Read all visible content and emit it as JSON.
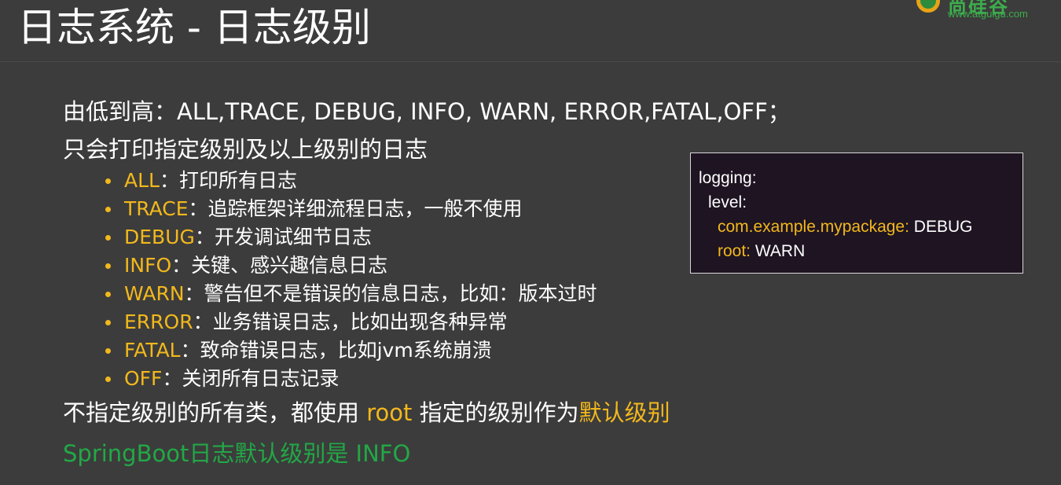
{
  "slide": {
    "title": "日志系统 - 日志级别",
    "logo": {
      "brand": "尚硅谷",
      "url": "www.atguigu.com"
    },
    "range_text": "由低到高：ALL,TRACE, DEBUG, INFO, WARN, ERROR,FATAL,OFF；",
    "only_text": "只会打印指定级别及以上级别的日志",
    "levels": [
      {
        "name": "ALL",
        "desc": "：打印所有日志"
      },
      {
        "name": "TRACE",
        "desc": "：追踪框架详细流程日志，一般不使用"
      },
      {
        "name": "DEBUG",
        "desc": "：开发调试细节日志"
      },
      {
        "name": "INFO",
        "desc": "：关键、感兴趣信息日志"
      },
      {
        "name": "WARN",
        "desc": "：警告但不是错误的信息日志，比如：版本过时"
      },
      {
        "name": "ERROR",
        "desc": "：业务错误日志，比如出现各种异常"
      },
      {
        "name": "FATAL",
        "desc": "：致命错误日志，比如jvm系统崩溃"
      },
      {
        "name": "OFF",
        "desc": "：关闭所有日志记录"
      }
    ],
    "root_line": {
      "part1": "不指定级别的所有类，都使用 ",
      "root": "root",
      "part2": " 指定的级别作为",
      "default": "默认级别"
    },
    "default_text": "SpringBoot日志默认级别是 INFO",
    "code": {
      "line1": "logging:",
      "line2": "level:",
      "pkg_key": "com.example.mypackage:",
      "pkg_val": " DEBUG",
      "root_key": "root:",
      "root_val": " WARN"
    }
  },
  "colors": {
    "background": "#3c3c3c",
    "text": "#ffffff",
    "accent_yellow": "#f2b81c",
    "accent_green": "#22a846",
    "code_background": "#1e1422"
  }
}
